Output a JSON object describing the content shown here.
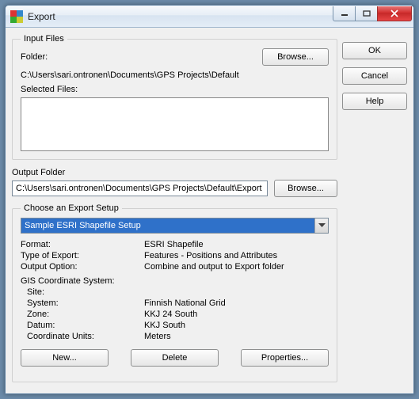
{
  "window": {
    "title": "Export"
  },
  "side": {
    "ok": "OK",
    "cancel": "Cancel",
    "help": "Help"
  },
  "input_files": {
    "legend": "Input Files",
    "folder_label": "Folder:",
    "browse": "Browse...",
    "folder_path": "C:\\Users\\sari.ontronen\\Documents\\GPS Projects\\Default",
    "selected_label": "Selected Files:"
  },
  "output": {
    "label": "Output Folder",
    "path": "C:\\Users\\sari.ontronen\\Documents\\GPS Projects\\Default\\Export",
    "browse": "Browse..."
  },
  "setup": {
    "legend": "Choose an Export Setup",
    "selected": "Sample ESRI Shapefile Setup",
    "format_label": "Format:",
    "format_value": "ESRI Shapefile",
    "type_label": "Type of Export:",
    "type_value": "Features - Positions and Attributes",
    "option_label": "Output Option:",
    "option_value": "Combine and output to Export folder",
    "gis_label": "GIS Coordinate System:",
    "site_label": "Site:",
    "site_value": "",
    "system_label": "System:",
    "system_value": "Finnish National Grid",
    "zone_label": "Zone:",
    "zone_value": "KKJ 24 South",
    "datum_label": "Datum:",
    "datum_value": "KKJ South",
    "units_label": "Coordinate Units:",
    "units_value": "Meters",
    "new_btn": "New...",
    "delete_btn": "Delete",
    "props_btn": "Properties..."
  }
}
